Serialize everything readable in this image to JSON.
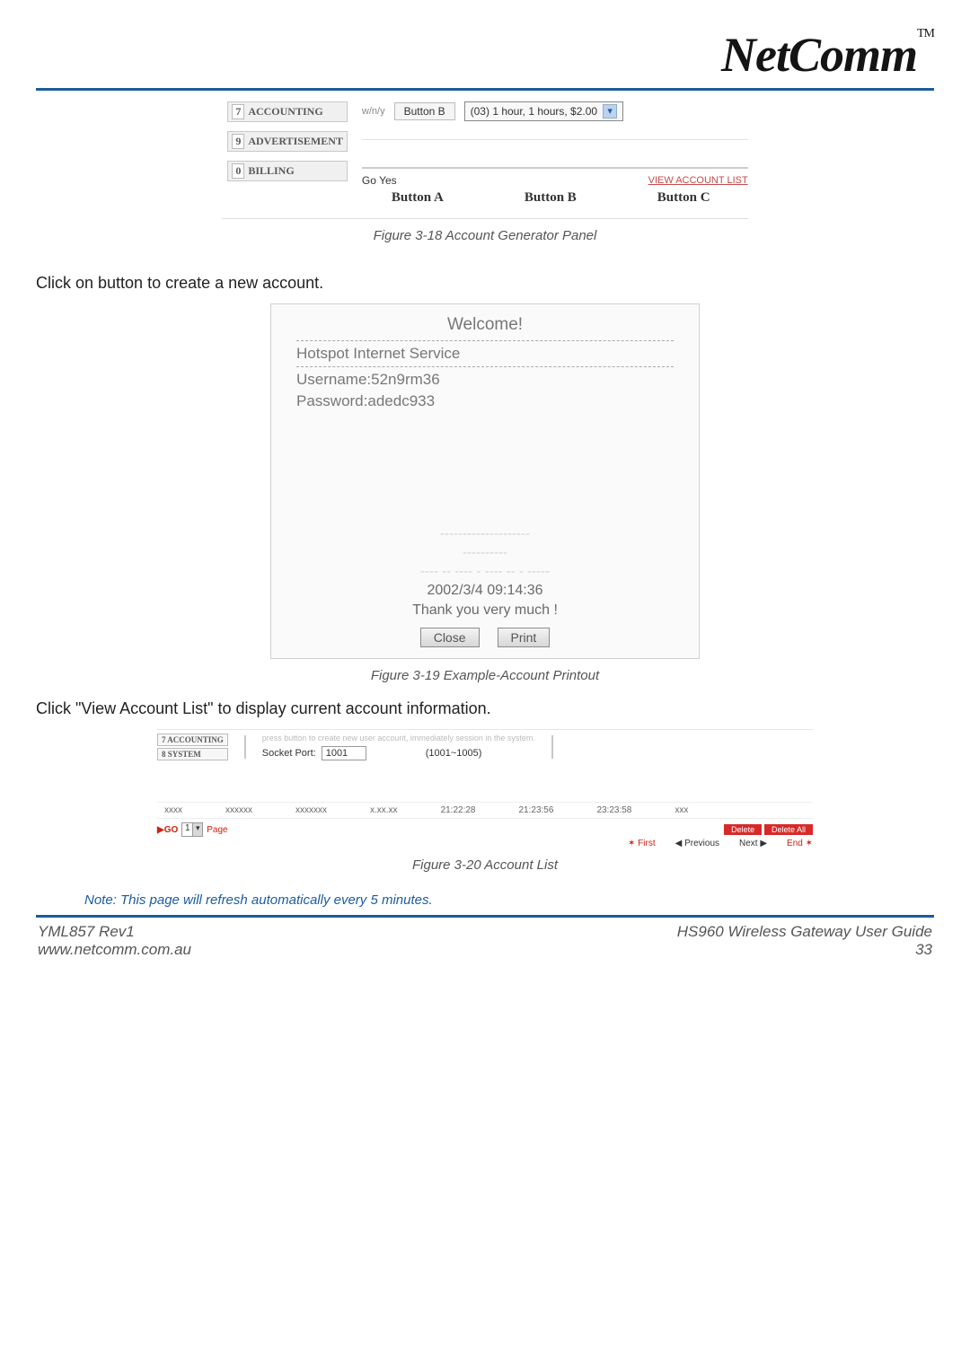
{
  "brand": {
    "name": "NetComm",
    "trademark": "TM"
  },
  "panel": {
    "nav": [
      {
        "num": "7",
        "label": "ACCOUNTING"
      },
      {
        "num": "9",
        "label": "ADVERTISEMENT"
      },
      {
        "num": "0",
        "label": "BILLING"
      }
    ],
    "row1": {
      "small": "w/n/y",
      "buttonB_label": "Button B",
      "dropdown": "(03) 1 hour, 1 hours, $2.00"
    },
    "row2": {
      "go": "Go",
      "yes": "Yes"
    },
    "view_account_list": "View Account List",
    "button_tags": [
      "Button A",
      "Button B",
      "Button C"
    ]
  },
  "captions": {
    "c1": "Figure 3-18 Account Generator Panel",
    "c2": "Figure 3-19 Example-Account Printout",
    "c3": "Figure 3-20 Account List"
  },
  "text": {
    "p1": "Click on button to create a new account.",
    "p2": "Click \"View Account List\" to display current account information.",
    "note": "Note: This page will refresh automatically every 5 minutes."
  },
  "printout": {
    "welcome": "Welcome!",
    "service": "Hotspot Internet Service",
    "user_label": "Username:",
    "username": "52n9rm36",
    "pass_label": "Password:",
    "password": "adedc933",
    "faint1": "--------------------",
    "faint2": "----------",
    "faint3": "---- -- ---- - ---- -- - -----",
    "datetime": "2002/3/4 09:14:36",
    "thanks": "Thank you very much !",
    "close": "Close",
    "print": "Print"
  },
  "acct": {
    "nav": [
      {
        "num": "7",
        "label": "ACCOUNTING"
      },
      {
        "num": "8",
        "label": "SYSTEM"
      }
    ],
    "hint_top": "press button to create new user account, immediately session in the system.",
    "socket_label": "Socket Port:",
    "socket_value": "1001",
    "socket_range": "(1001~1005)",
    "row": [
      "xxxx",
      "xxxxxx",
      "xxxxxxx",
      "x.xx.xx",
      "21:22:28",
      "21:23:56",
      "23:23:58",
      "xxx"
    ],
    "delete": "Delete",
    "delete_all": "Delete All",
    "pager": {
      "go": "GO",
      "page": "Page",
      "first": "First",
      "prev": "Previous",
      "next": "Next",
      "end": "End",
      "value": "1"
    }
  },
  "footer": {
    "l1": "YML857 Rev1",
    "l2": "www.netcomm.com.au",
    "r1": "HS960 Wireless Gateway User Guide",
    "r2": "33"
  }
}
